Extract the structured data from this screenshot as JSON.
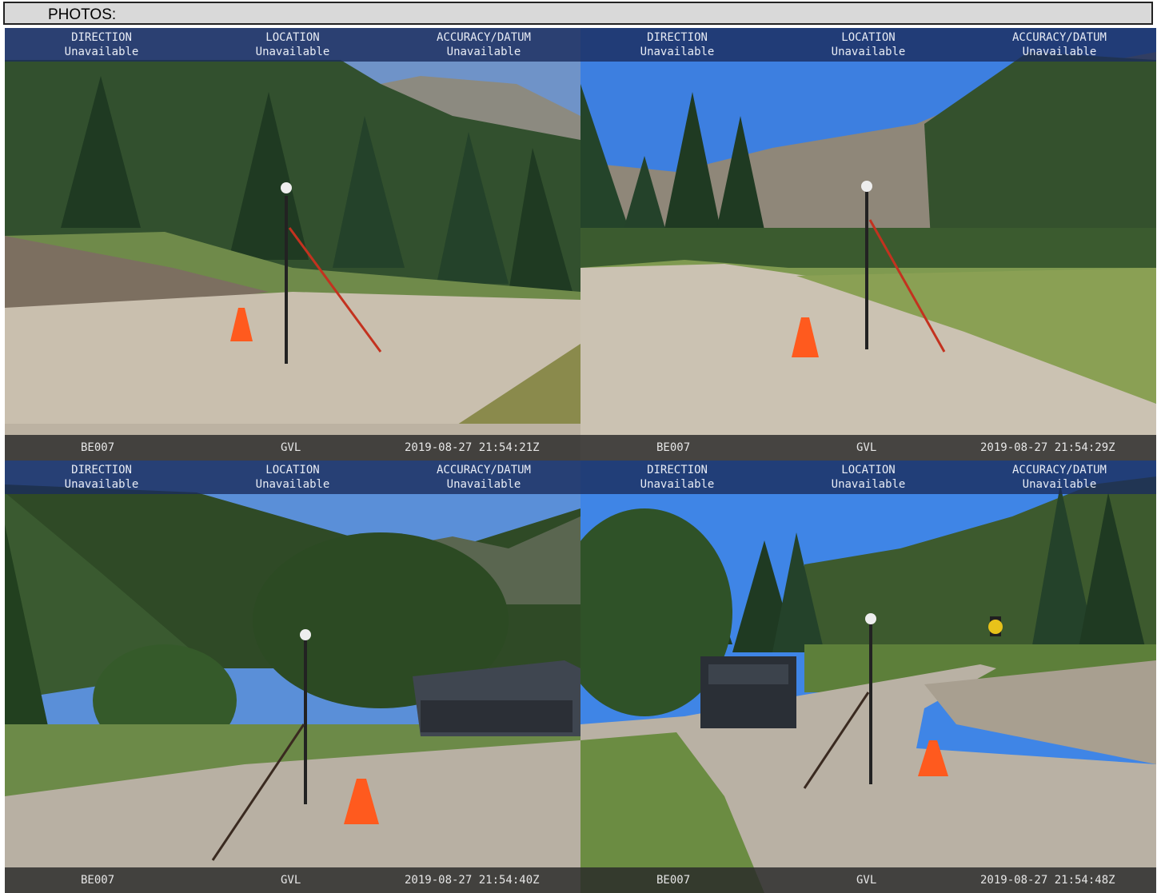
{
  "header": {
    "title": "PHOTOS:"
  },
  "overlay_labels": {
    "direction": "DIRECTION",
    "location": "LOCATION",
    "accuracy": "ACCURACY/DATUM"
  },
  "photos": [
    {
      "direction": "Unavailable",
      "location": "Unavailable",
      "accuracy": "Unavailable",
      "id": "BE007",
      "source": "GVL",
      "timestamp": "2019-08-27 21:54:21Z"
    },
    {
      "direction": "Unavailable",
      "location": "Unavailable",
      "accuracy": "Unavailable",
      "id": "BE007",
      "source": "GVL",
      "timestamp": "2019-08-27 21:54:29Z"
    },
    {
      "direction": "Unavailable",
      "location": "Unavailable",
      "accuracy": "Unavailable",
      "id": "BE007",
      "source": "GVL",
      "timestamp": "2019-08-27 21:54:40Z"
    },
    {
      "direction": "Unavailable",
      "location": "Unavailable",
      "accuracy": "Unavailable",
      "id": "BE007",
      "source": "GVL",
      "timestamp": "2019-08-27 21:54:48Z"
    }
  ]
}
